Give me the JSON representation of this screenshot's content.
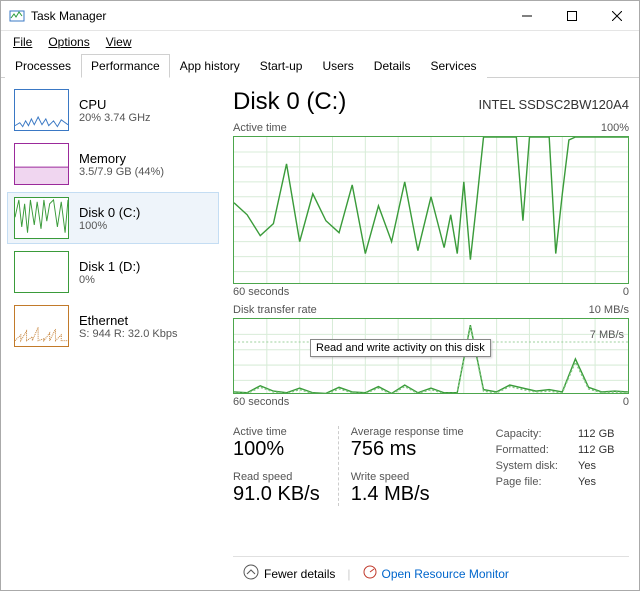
{
  "window_title": "Task Manager",
  "menus": {
    "file": "File",
    "options": "Options",
    "view": "View"
  },
  "tabs": [
    "Processes",
    "Performance",
    "App history",
    "Start-up",
    "Users",
    "Details",
    "Services"
  ],
  "active_tab": 1,
  "sidebar": {
    "items": [
      {
        "key": "cpu",
        "title": "CPU",
        "sub": "20%  3.74 GHz"
      },
      {
        "key": "mem",
        "title": "Memory",
        "sub": "3.5/7.9 GB (44%)"
      },
      {
        "key": "disk0",
        "title": "Disk 0 (C:)",
        "sub": "100%"
      },
      {
        "key": "disk1",
        "title": "Disk 1 (D:)",
        "sub": "0%"
      },
      {
        "key": "eth",
        "title": "Ethernet",
        "sub": "S: 944 R: 32.0 Kbps"
      }
    ],
    "selected": 2
  },
  "header": {
    "title": "Disk 0 (C:)",
    "model": "INTEL SSDSC2BW120A4"
  },
  "chart1": {
    "label": "Active time",
    "max_label": "100%",
    "x_left": "60 seconds",
    "x_right": "0"
  },
  "chart2": {
    "label": "Disk transfer rate",
    "max_label": "10 MB/s",
    "tick_label": "7 MB/s",
    "x_left": "60 seconds",
    "x_right": "0",
    "tooltip": "Read and write activity on this disk"
  },
  "stats": {
    "active_time_label": "Active time",
    "active_time_value": "100%",
    "response_label": "Average response time",
    "response_value": "756 ms",
    "read_speed_label": "Read speed",
    "read_speed_value": "91.0 KB/s",
    "write_speed_label": "Write speed",
    "write_speed_value": "1.4 MB/s"
  },
  "kv": [
    {
      "k": "Capacity:",
      "v": "112 GB"
    },
    {
      "k": "Formatted:",
      "v": "112 GB"
    },
    {
      "k": "System disk:",
      "v": "Yes"
    },
    {
      "k": "Page file:",
      "v": "Yes"
    }
  ],
  "footer": {
    "fewer": "Fewer details",
    "orm": "Open Resource Monitor"
  },
  "chart_data": [
    {
      "type": "line",
      "title": "Active time",
      "xlabel": "seconds",
      "ylabel": "% active time",
      "x_range": [
        60,
        0
      ],
      "ylim": [
        0,
        100
      ],
      "x": [
        60,
        58,
        56,
        54,
        52,
        50,
        48,
        46,
        44,
        42,
        40,
        38,
        36,
        34,
        32,
        30,
        28,
        27,
        26,
        25,
        24,
        23,
        22,
        21,
        20,
        19,
        18,
        17,
        16,
        15,
        14,
        13,
        12,
        11,
        10,
        9,
        8,
        7,
        6,
        5,
        4,
        3,
        2,
        1,
        0
      ],
      "series": [
        {
          "name": "Active time %",
          "values": [
            56,
            48,
            34,
            42,
            82,
            30,
            62,
            44,
            36,
            68,
            22,
            54,
            30,
            70,
            24,
            60,
            26,
            48,
            22,
            70,
            18,
            58,
            100,
            100,
            100,
            100,
            100,
            100,
            44,
            100,
            100,
            100,
            100,
            22,
            62,
            98,
            100,
            100,
            100,
            100,
            100,
            100,
            100,
            100,
            100
          ]
        }
      ]
    },
    {
      "type": "line",
      "title": "Disk transfer rate",
      "xlabel": "seconds",
      "ylabel": "MB/s",
      "x_range": [
        60,
        0
      ],
      "ylim": [
        0,
        10
      ],
      "x": [
        60,
        58,
        56,
        54,
        52,
        50,
        48,
        46,
        44,
        42,
        40,
        38,
        36,
        34,
        32,
        30,
        28,
        26,
        24,
        22,
        20,
        18,
        16,
        14,
        12,
        10,
        8,
        6,
        4,
        2,
        0
      ],
      "series": [
        {
          "name": "Read",
          "values": [
            0.4,
            0.3,
            1.1,
            0.5,
            0.3,
            0.8,
            0.3,
            0.2,
            0.9,
            0.4,
            0.3,
            1.0,
            0.2,
            1.2,
            0.3,
            0.8,
            0.3,
            0.3,
            9.0,
            0.6,
            0.4,
            1.2,
            0.8,
            0.5,
            0.6,
            0.4,
            4.4,
            0.9,
            0.4,
            0.5,
            0.4
          ]
        },
        {
          "name": "Write",
          "values": [
            0.5,
            0.4,
            1.3,
            0.6,
            0.4,
            1.0,
            0.4,
            0.3,
            1.1,
            0.5,
            0.4,
            1.2,
            0.3,
            1.4,
            0.4,
            1.0,
            0.4,
            0.4,
            9.2,
            0.8,
            0.5,
            1.4,
            1.0,
            0.6,
            0.8,
            0.5,
            4.8,
            1.1,
            0.5,
            0.6,
            0.5
          ]
        }
      ]
    }
  ]
}
